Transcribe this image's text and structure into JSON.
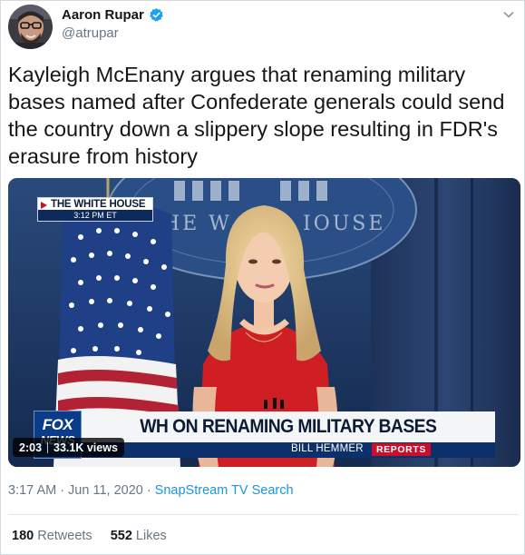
{
  "author": {
    "display_name": "Aaron Rupar",
    "handle": "@atrupar",
    "verified": true,
    "avatar_icon": "avatar-photo"
  },
  "tweet": {
    "text": "Kayleigh McEnany argues that renaming military bases named after Confederate generals could send the country down a slippery slope resulting in FDR's erasure from history"
  },
  "media": {
    "type": "video",
    "duration": "2:03",
    "views": "33.1K views",
    "broadcast": {
      "bug_title": "THE WHITE HOUSE",
      "bug_time": "3:12 PM ET",
      "podium_text": "THE WHITE HOUSE",
      "network_line1": "FOX",
      "network_line2": "NEWS",
      "headline": "WH ON RENAMING MILITARY BASES",
      "anchor": "BILL HEMMER",
      "segment": "REPORTS"
    }
  },
  "meta": {
    "time": "3:17 AM",
    "separator": "·",
    "date": "Jun 11, 2020",
    "source": "SnapStream TV Search"
  },
  "stats": {
    "retweets_count": "180",
    "retweets_label": "Retweets",
    "likes_count": "552",
    "likes_label": "Likes"
  },
  "colors": {
    "text": "#14171a",
    "secondary": "#657786",
    "link": "#1b95e0",
    "verified": "#1da1f2",
    "fox_red": "#c8102e",
    "fox_blue": "#0d2f6b"
  },
  "icons": {
    "verified": "verified-badge-icon",
    "menu": "chevron-down-icon"
  }
}
